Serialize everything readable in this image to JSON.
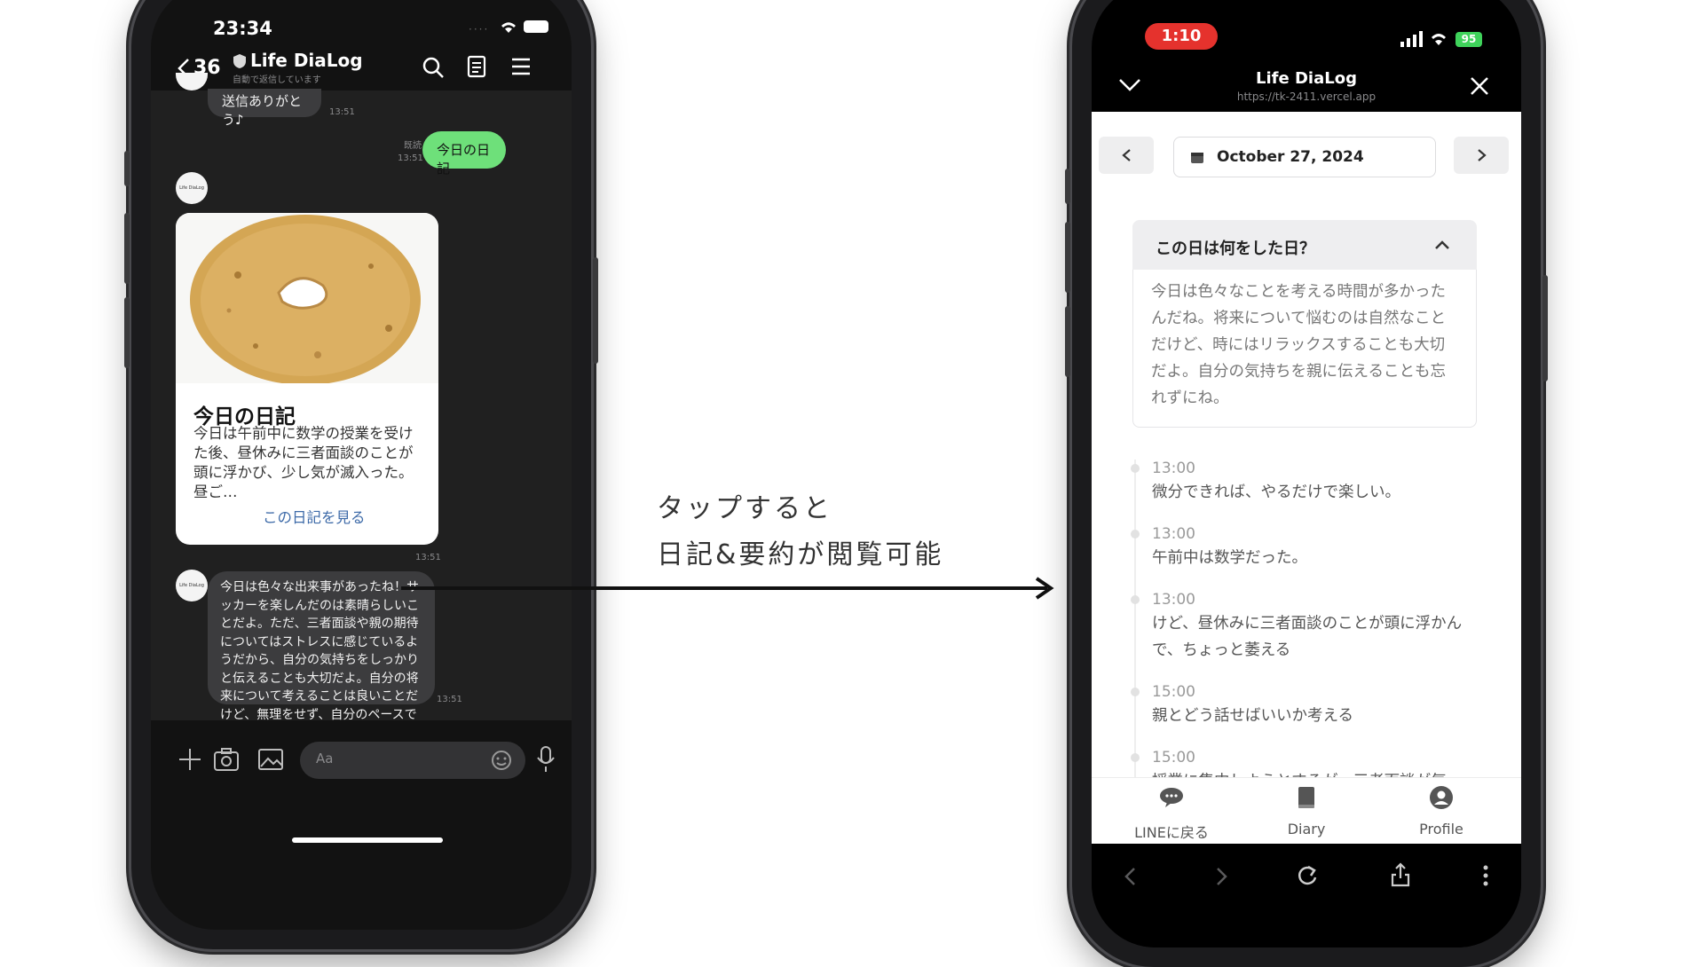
{
  "left_phone": {
    "status_time": "23:34",
    "header": {
      "back_count": "36",
      "title": "Life DiaLog",
      "subtitle": "自動で返信しています"
    },
    "messages": {
      "top_bubble": "送信ありがとう♪",
      "top_time": "13:51",
      "sent_read": "既読",
      "sent_time": "13:51",
      "sent_text": "今日の日記",
      "avatar_text": "Life DiaLog",
      "card_title": "今日の日記",
      "card_body": "今日は午前中に数学の授業を受けた後、昼休みに三者面談のことが頭に浮かび、少し気が滅入った。昼ご…",
      "card_link": "この日記を見る",
      "card_time": "13:51",
      "reply_text": "今日は色々な出来事があったね！サッカーを楽しんだのは素晴らしいことだよ。ただ、三者面談や親の期待についてはストレスに感じているようだから、自分の気持ちをしっかりと伝えることも大切だよ。自分の将来について考えることは良いことだけど、無理をせず、自分のペースで進んでいこうね。",
      "reply_time": "13:51"
    },
    "input_placeholder": "Aa"
  },
  "caption": {
    "line1": "タップすると",
    "line2": "日記&要約が閲覧可能"
  },
  "right_phone": {
    "status_time": "1:10",
    "battery": "95",
    "header": {
      "title": "Life DiaLog",
      "url": "https://tk-2411.vercel.app"
    },
    "date": "October 27, 2024",
    "summary": {
      "title": "この日は何をした日？",
      "body": "今日は色々なことを考える時間が多かったんだね。将来について悩むのは自然なことだけど、時にはリラックスすることも大切だよ。自分の気持ちを親に伝えることも忘れずにね。"
    },
    "timeline": [
      {
        "time": "13:00",
        "text": "微分できれば、やるだけで楽しい。"
      },
      {
        "time": "13:00",
        "text": "午前中は数学だった。"
      },
      {
        "time": "13:00",
        "text": "けど、昼休みに三者面談のことが頭に浮かんで、ちょっと萎える"
      },
      {
        "time": "15:00",
        "text": "親とどう話せばいいか考える"
      },
      {
        "time": "15:00",
        "text": "授業に集中しようとするが、三者面談が気"
      }
    ],
    "tabs": [
      {
        "label": "LINEに戻る",
        "icon": "chat-bubble-icon"
      },
      {
        "label": "Diary",
        "icon": "book-icon"
      },
      {
        "label": "Profile",
        "icon": "person-icon"
      }
    ]
  },
  "colors": {
    "line_green": "#6ee07a",
    "chat_bg": "#202020",
    "link_blue": "#3d6aa8",
    "recording_red": "#e5322d"
  }
}
